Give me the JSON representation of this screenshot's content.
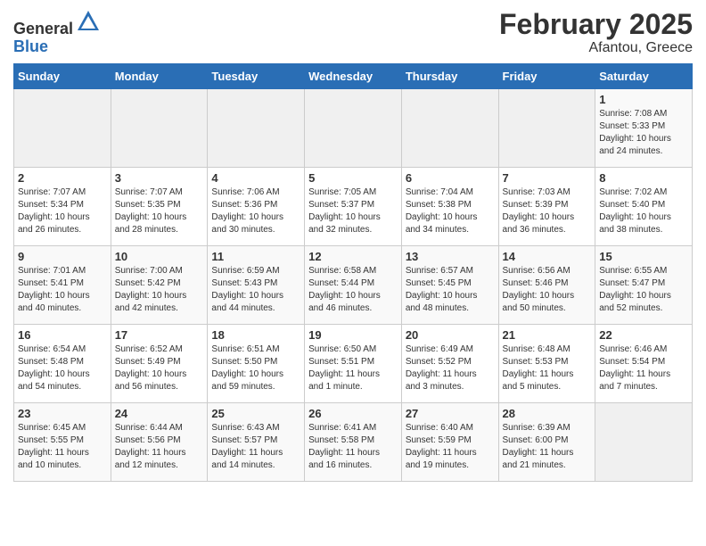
{
  "header": {
    "logo_general": "General",
    "logo_blue": "Blue",
    "title": "February 2025",
    "subtitle": "Afantou, Greece"
  },
  "weekdays": [
    "Sunday",
    "Monday",
    "Tuesday",
    "Wednesday",
    "Thursday",
    "Friday",
    "Saturday"
  ],
  "weeks": [
    [
      {
        "day": "",
        "detail": ""
      },
      {
        "day": "",
        "detail": ""
      },
      {
        "day": "",
        "detail": ""
      },
      {
        "day": "",
        "detail": ""
      },
      {
        "day": "",
        "detail": ""
      },
      {
        "day": "",
        "detail": ""
      },
      {
        "day": "1",
        "detail": "Sunrise: 7:08 AM\nSunset: 5:33 PM\nDaylight: 10 hours\nand 24 minutes."
      }
    ],
    [
      {
        "day": "2",
        "detail": "Sunrise: 7:07 AM\nSunset: 5:34 PM\nDaylight: 10 hours\nand 26 minutes."
      },
      {
        "day": "3",
        "detail": "Sunrise: 7:07 AM\nSunset: 5:35 PM\nDaylight: 10 hours\nand 28 minutes."
      },
      {
        "day": "4",
        "detail": "Sunrise: 7:06 AM\nSunset: 5:36 PM\nDaylight: 10 hours\nand 30 minutes."
      },
      {
        "day": "5",
        "detail": "Sunrise: 7:05 AM\nSunset: 5:37 PM\nDaylight: 10 hours\nand 32 minutes."
      },
      {
        "day": "6",
        "detail": "Sunrise: 7:04 AM\nSunset: 5:38 PM\nDaylight: 10 hours\nand 34 minutes."
      },
      {
        "day": "7",
        "detail": "Sunrise: 7:03 AM\nSunset: 5:39 PM\nDaylight: 10 hours\nand 36 minutes."
      },
      {
        "day": "8",
        "detail": "Sunrise: 7:02 AM\nSunset: 5:40 PM\nDaylight: 10 hours\nand 38 minutes."
      }
    ],
    [
      {
        "day": "9",
        "detail": "Sunrise: 7:01 AM\nSunset: 5:41 PM\nDaylight: 10 hours\nand 40 minutes."
      },
      {
        "day": "10",
        "detail": "Sunrise: 7:00 AM\nSunset: 5:42 PM\nDaylight: 10 hours\nand 42 minutes."
      },
      {
        "day": "11",
        "detail": "Sunrise: 6:59 AM\nSunset: 5:43 PM\nDaylight: 10 hours\nand 44 minutes."
      },
      {
        "day": "12",
        "detail": "Sunrise: 6:58 AM\nSunset: 5:44 PM\nDaylight: 10 hours\nand 46 minutes."
      },
      {
        "day": "13",
        "detail": "Sunrise: 6:57 AM\nSunset: 5:45 PM\nDaylight: 10 hours\nand 48 minutes."
      },
      {
        "day": "14",
        "detail": "Sunrise: 6:56 AM\nSunset: 5:46 PM\nDaylight: 10 hours\nand 50 minutes."
      },
      {
        "day": "15",
        "detail": "Sunrise: 6:55 AM\nSunset: 5:47 PM\nDaylight: 10 hours\nand 52 minutes."
      }
    ],
    [
      {
        "day": "16",
        "detail": "Sunrise: 6:54 AM\nSunset: 5:48 PM\nDaylight: 10 hours\nand 54 minutes."
      },
      {
        "day": "17",
        "detail": "Sunrise: 6:52 AM\nSunset: 5:49 PM\nDaylight: 10 hours\nand 56 minutes."
      },
      {
        "day": "18",
        "detail": "Sunrise: 6:51 AM\nSunset: 5:50 PM\nDaylight: 10 hours\nand 59 minutes."
      },
      {
        "day": "19",
        "detail": "Sunrise: 6:50 AM\nSunset: 5:51 PM\nDaylight: 11 hours\nand 1 minute."
      },
      {
        "day": "20",
        "detail": "Sunrise: 6:49 AM\nSunset: 5:52 PM\nDaylight: 11 hours\nand 3 minutes."
      },
      {
        "day": "21",
        "detail": "Sunrise: 6:48 AM\nSunset: 5:53 PM\nDaylight: 11 hours\nand 5 minutes."
      },
      {
        "day": "22",
        "detail": "Sunrise: 6:46 AM\nSunset: 5:54 PM\nDaylight: 11 hours\nand 7 minutes."
      }
    ],
    [
      {
        "day": "23",
        "detail": "Sunrise: 6:45 AM\nSunset: 5:55 PM\nDaylight: 11 hours\nand 10 minutes."
      },
      {
        "day": "24",
        "detail": "Sunrise: 6:44 AM\nSunset: 5:56 PM\nDaylight: 11 hours\nand 12 minutes."
      },
      {
        "day": "25",
        "detail": "Sunrise: 6:43 AM\nSunset: 5:57 PM\nDaylight: 11 hours\nand 14 minutes."
      },
      {
        "day": "26",
        "detail": "Sunrise: 6:41 AM\nSunset: 5:58 PM\nDaylight: 11 hours\nand 16 minutes."
      },
      {
        "day": "27",
        "detail": "Sunrise: 6:40 AM\nSunset: 5:59 PM\nDaylight: 11 hours\nand 19 minutes."
      },
      {
        "day": "28",
        "detail": "Sunrise: 6:39 AM\nSunset: 6:00 PM\nDaylight: 11 hours\nand 21 minutes."
      },
      {
        "day": "",
        "detail": ""
      }
    ]
  ]
}
